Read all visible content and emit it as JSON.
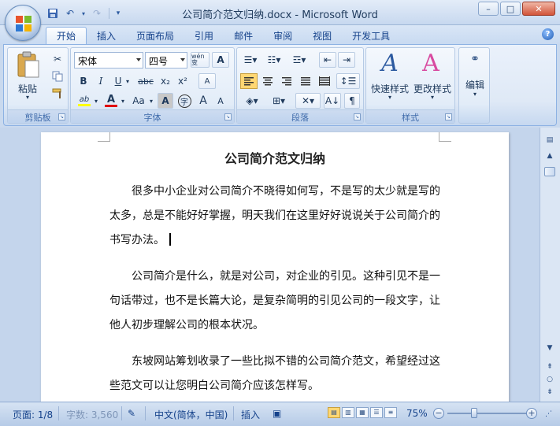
{
  "window": {
    "title": "公司简介范文归纳.docx - Microsoft Word",
    "minimize": "–",
    "maximize": "□",
    "close": "✕"
  },
  "qat": {
    "save_icon": "save-icon",
    "undo_icon": "undo-icon",
    "redo_icon": "redo-icon",
    "customize": "▾"
  },
  "tabs": [
    "开始",
    "插入",
    "页面布局",
    "引用",
    "邮件",
    "审阅",
    "视图",
    "开发工具"
  ],
  "ribbon": {
    "clipboard": {
      "label": "剪贴板",
      "paste": "粘贴"
    },
    "font": {
      "label": "字体",
      "font_name": "宋体",
      "font_size": "四号",
      "phonetic": "wén 变",
      "charborder": "A",
      "bold": "B",
      "italic": "I",
      "underline": "U",
      "strike": "abc",
      "subscript": "x₂",
      "superscript": "x²",
      "clear": "A",
      "highlight": "ab",
      "fontcolor": "A",
      "changecase": "Aa",
      "shade": "A",
      "circle": "字",
      "grow": "A",
      "shrink": "A"
    },
    "paragraph": {
      "label": "段落"
    },
    "styles": {
      "label": "样式",
      "quick": "快速样式",
      "change": "更改样式"
    },
    "editing": {
      "label": "编辑"
    }
  },
  "document": {
    "title": "公司简介范文归纳",
    "paragraphs": [
      "很多中小企业对公司简介不晓得如何写，不是写的太少就是写的太多，总是不能好好掌握，明天我们在这里好好说说关于公司简介的书写办法。",
      "公司简介是什么，就是对公司，对企业的引见。这种引见不是一句话带过，也不是长篇大论，是复杂简明的引见公司的一段文字，让他人初步理解公司的根本状况。",
      "东坡网站筹划收录了一些比拟不错的公司简介范文，希望经过这些范文可以让您明白公司简介应该怎样写。"
    ]
  },
  "status": {
    "page": "页面: 1/8",
    "words": "字数: 3,560",
    "language": "中文(简体，中国)",
    "mode": "插入",
    "zoom": "75%",
    "zoom_fraction": 0.75
  },
  "colors": {
    "accent": "#15428b",
    "highlight": "#ffff00",
    "fontcolor": "#e00000"
  }
}
